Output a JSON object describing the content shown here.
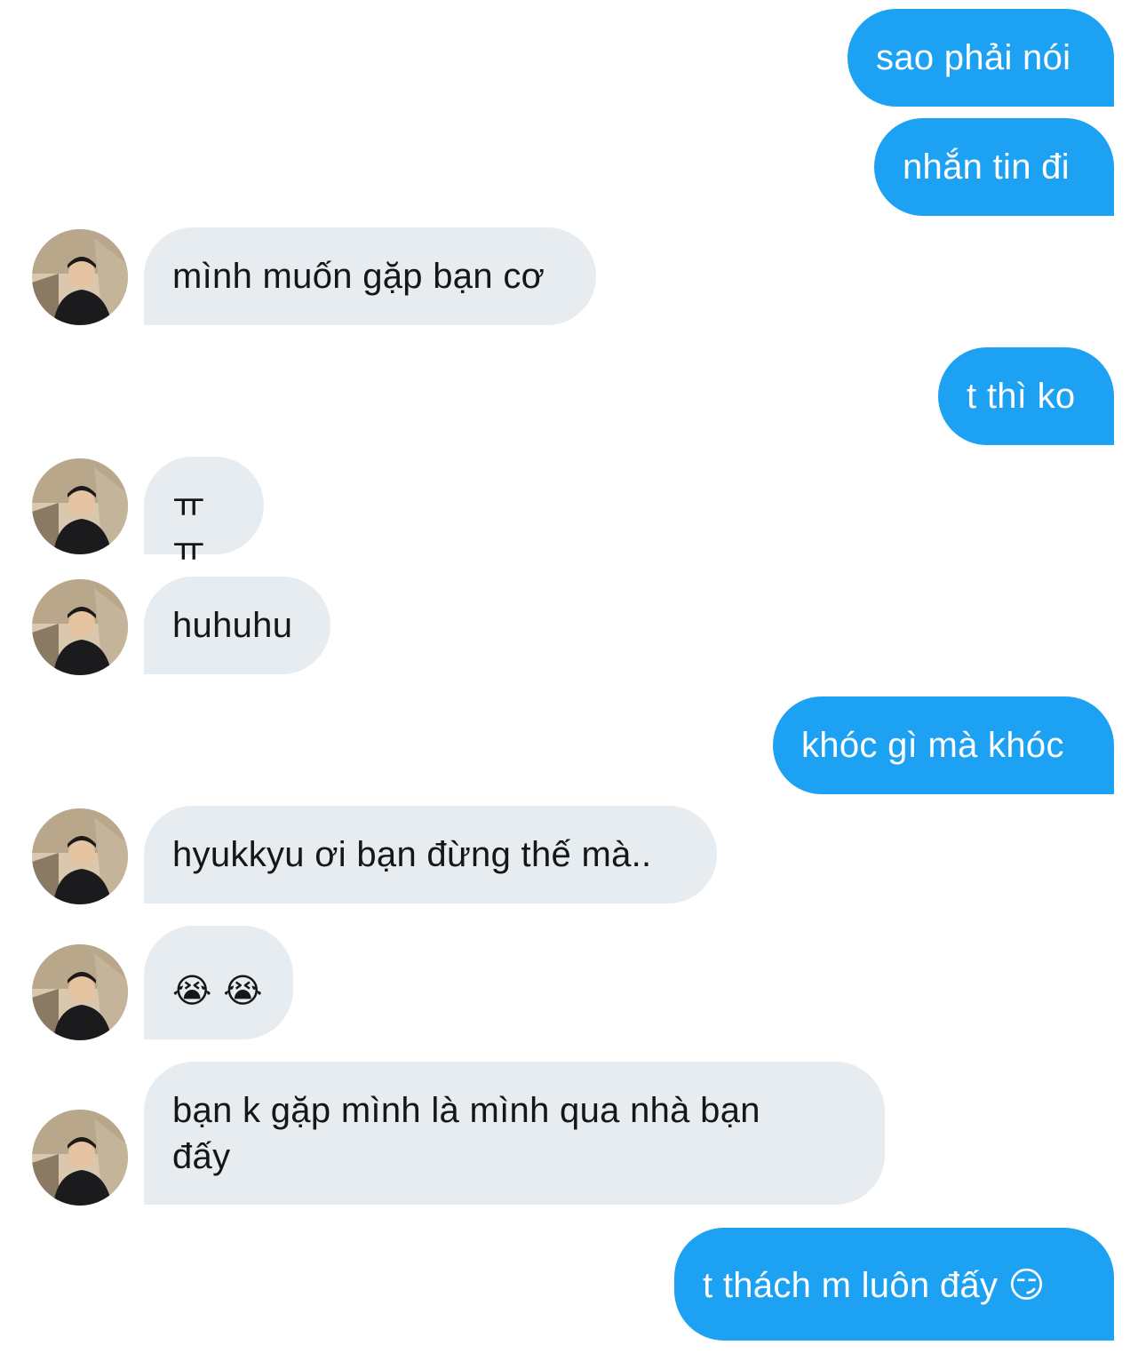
{
  "messages": [
    {
      "id": "m1",
      "from": "me",
      "text": "sao phải nói"
    },
    {
      "id": "m2",
      "from": "me",
      "text": "nhắn tin đi"
    },
    {
      "id": "m3",
      "from": "them",
      "text": "mình muốn gặp bạn cơ"
    },
    {
      "id": "m4",
      "from": "me",
      "text": "t thì ko"
    },
    {
      "id": "m5",
      "from": "them",
      "text": "ㅠㅠ"
    },
    {
      "id": "m6",
      "from": "them",
      "text": "huhuhu"
    },
    {
      "id": "m7",
      "from": "me",
      "text": "khóc gì mà khóc"
    },
    {
      "id": "m8",
      "from": "them",
      "text": "hyukkyu ơi bạn đừng thế mà.."
    },
    {
      "id": "m9",
      "from": "them",
      "text": "😭 😭"
    },
    {
      "id": "m10",
      "from": "them",
      "text": "bạn k gặp mình là mình qua nhà bạn đấy"
    },
    {
      "id": "m11",
      "from": "me",
      "text": "t thách m luôn đấy 😏"
    }
  ],
  "colors": {
    "sent_bubble": "#1DA1F2",
    "received_bubble": "#E6ECF0",
    "received_text": "#14171A",
    "sent_text": "#FFFFFF"
  },
  "icons": {
    "avatar": "user-avatar-photo"
  }
}
